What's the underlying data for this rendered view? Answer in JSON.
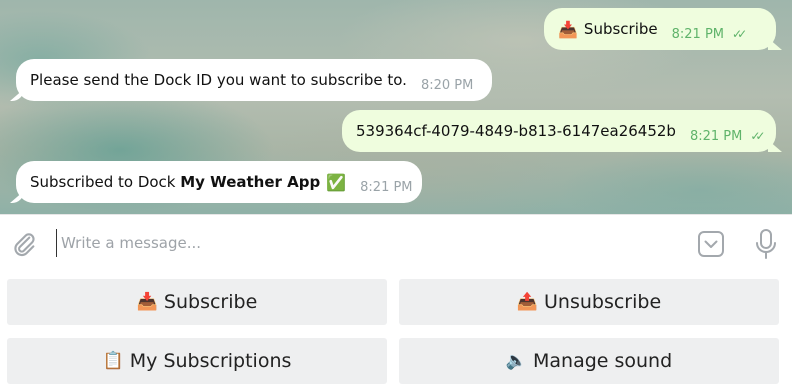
{
  "messages": [
    {
      "dir": "out",
      "icon": "📥",
      "text": "Subscribe",
      "time": "8:21 PM",
      "ticks": "✓✓"
    },
    {
      "dir": "in",
      "text": "Please send the Dock ID you want to subscribe to.",
      "time": "8:20 PM"
    },
    {
      "dir": "out",
      "text": "539364cf-4079-4849-b813-6147ea26452b",
      "time": "8:21 PM",
      "ticks": "✓✓"
    },
    {
      "dir": "in",
      "text_prefix": "Subscribed to Dock ",
      "bold": "My Weather App",
      "emoji": "✅",
      "time": "8:21 PM"
    }
  ],
  "composer": {
    "placeholder": "Write a message..."
  },
  "keyboard": [
    {
      "icon": "📥",
      "label": "Subscribe"
    },
    {
      "icon": "📤",
      "label": "Unsubscribe"
    },
    {
      "icon": "📋",
      "label": "My Subscriptions"
    },
    {
      "icon": "🔈",
      "label": "Manage sound"
    }
  ]
}
